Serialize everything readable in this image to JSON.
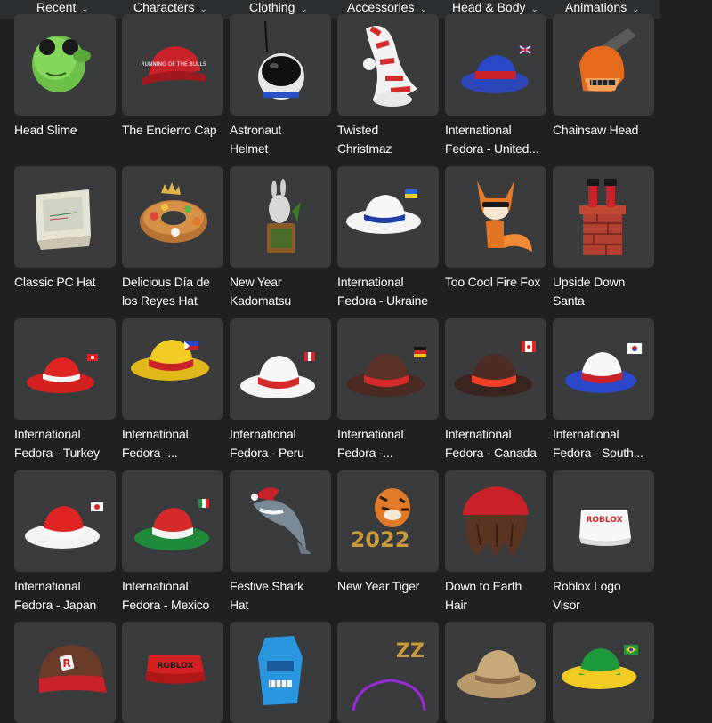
{
  "tabs": [
    {
      "label": "Recent",
      "active": false
    },
    {
      "label": "Characters",
      "active": false
    },
    {
      "label": "Clothing",
      "active": false
    },
    {
      "label": "Accessories",
      "active": true
    },
    {
      "label": "Head & Body",
      "active": false
    },
    {
      "label": "Animations",
      "active": false
    }
  ],
  "items": [
    {
      "name": "Head Slime",
      "lines": [
        "Head Slime"
      ],
      "icon": "head-slime-icon"
    },
    {
      "name": "The Encierro Cap",
      "lines": [
        "The Encierro Cap"
      ],
      "icon": "red-cap-icon"
    },
    {
      "name": "Astronaut Helmet",
      "lines": [
        "Astronaut",
        "Helmet"
      ],
      "icon": "astronaut-helmet-icon"
    },
    {
      "name": "Twisted Christmaz",
      "lines": [
        "Twisted",
        "Christmaz"
      ],
      "icon": "candy-stripe-hat-icon"
    },
    {
      "name": "International Fedora - United...",
      "lines": [
        "International",
        "Fedora - United..."
      ],
      "icon": "fedora-uk-icon"
    },
    {
      "name": "Chainsaw Head",
      "lines": [
        "Chainsaw Head"
      ],
      "icon": "chainsaw-head-icon"
    },
    {
      "name": "Classic PC Hat",
      "lines": [
        "Classic PC Hat"
      ],
      "icon": "pc-monitor-hat-icon"
    },
    {
      "name": "Delicious Día de los Reyes Hat",
      "lines": [
        "Delicious Día de",
        "los Reyes Hat"
      ],
      "icon": "rosca-cake-hat-icon"
    },
    {
      "name": "New Year Kadomatsu",
      "lines": [
        "New Year",
        "Kadomatsu"
      ],
      "icon": "kadomatsu-rabbit-icon"
    },
    {
      "name": "International Fedora - Ukraine",
      "lines": [
        "International",
        "Fedora - Ukraine"
      ],
      "icon": "fedora-ukraine-icon"
    },
    {
      "name": "Too Cool Fire Fox",
      "lines": [
        "Too Cool Fire Fox"
      ],
      "icon": "fire-fox-icon"
    },
    {
      "name": "Upside Down Santa",
      "lines": [
        "Upside Down",
        "Santa"
      ],
      "icon": "santa-chimney-icon"
    },
    {
      "name": "International Fedora - Turkey",
      "lines": [
        "International",
        "Fedora - Turkey"
      ],
      "icon": "fedora-turkey-icon"
    },
    {
      "name": "International Fedora -...",
      "lines": [
        "International",
        "Fedora -..."
      ],
      "icon": "fedora-philippines-icon"
    },
    {
      "name": "International Fedora - Peru",
      "lines": [
        "International",
        "Fedora - Peru"
      ],
      "icon": "fedora-peru-icon"
    },
    {
      "name": "International Fedora -...",
      "lines": [
        "International",
        "Fedora -..."
      ],
      "icon": "fedora-germany-icon"
    },
    {
      "name": "International Fedora - Canada",
      "lines": [
        "International",
        "Fedora - Canada"
      ],
      "icon": "fedora-canada-icon"
    },
    {
      "name": "International Fedora - South...",
      "lines": [
        "International",
        "Fedora - South..."
      ],
      "icon": "fedora-korea-icon"
    },
    {
      "name": "International Fedora - Japan",
      "lines": [
        "International",
        "Fedora - Japan"
      ],
      "icon": "fedora-japan-icon"
    },
    {
      "name": "International Fedora - Mexico",
      "lines": [
        "International",
        "Fedora - Mexico"
      ],
      "icon": "fedora-mexico-icon"
    },
    {
      "name": "Festive Shark Hat",
      "lines": [
        "Festive Shark",
        "Hat"
      ],
      "icon": "festive-shark-icon"
    },
    {
      "name": "New Year Tiger",
      "lines": [
        "New Year Tiger"
      ],
      "icon": "tiger-2022-icon"
    },
    {
      "name": "Down to Earth Hair",
      "lines": [
        "Down to Earth",
        "Hair"
      ],
      "icon": "beanie-hair-icon"
    },
    {
      "name": "Roblox Logo Visor",
      "lines": [
        "Roblox Logo",
        "Visor"
      ],
      "icon": "roblox-visor-icon"
    },
    {
      "name": "",
      "lines": [],
      "icon": "roblox-cap-icon"
    },
    {
      "name": "",
      "lines": [],
      "icon": "roblox-red-visor-icon"
    },
    {
      "name": "",
      "lines": [],
      "icon": "blue-robot-head-icon"
    },
    {
      "name": "",
      "lines": [],
      "icon": "zzz-headband-icon"
    },
    {
      "name": "",
      "lines": [],
      "icon": "straw-cowboy-hat-icon"
    },
    {
      "name": "",
      "lines": [],
      "icon": "fedora-brazil-icon"
    }
  ],
  "texts": {
    "cap_text": "RUNNING OF THE BULLS",
    "tiger_year": "2022",
    "roblox_logo": "ROBLOX",
    "robx_visor": "ROBLOX",
    "zzz": "ZZ"
  },
  "colors": {
    "background": "#1e2021",
    "tab_bar": "#2b2e30",
    "tile": "#393b3d",
    "text": "#ffffff"
  }
}
